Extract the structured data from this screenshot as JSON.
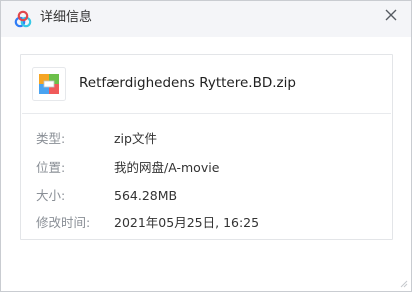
{
  "window": {
    "title": "详细信息",
    "app_icon": "baidu-netdisk-logo",
    "close_icon": "close-icon"
  },
  "file": {
    "icon": "zip-file-icon",
    "name": "Retfærdighedens Ryttere.BD.zip"
  },
  "details": [
    {
      "label": "类型:",
      "value": "zip文件"
    },
    {
      "label": "位置:",
      "value": "我的网盘/A-movie"
    },
    {
      "label": "大小:",
      "value": "564.28MB"
    },
    {
      "label": "修改时间:",
      "value": "2021年05月25日, 16:25"
    }
  ],
  "colors": {
    "titlebar_bg": "#f4f5f8",
    "label_text": "#8a8f96",
    "value_text": "#333333",
    "logo_blue": "#2f7cf6",
    "logo_teal": "#38c8e6"
  }
}
